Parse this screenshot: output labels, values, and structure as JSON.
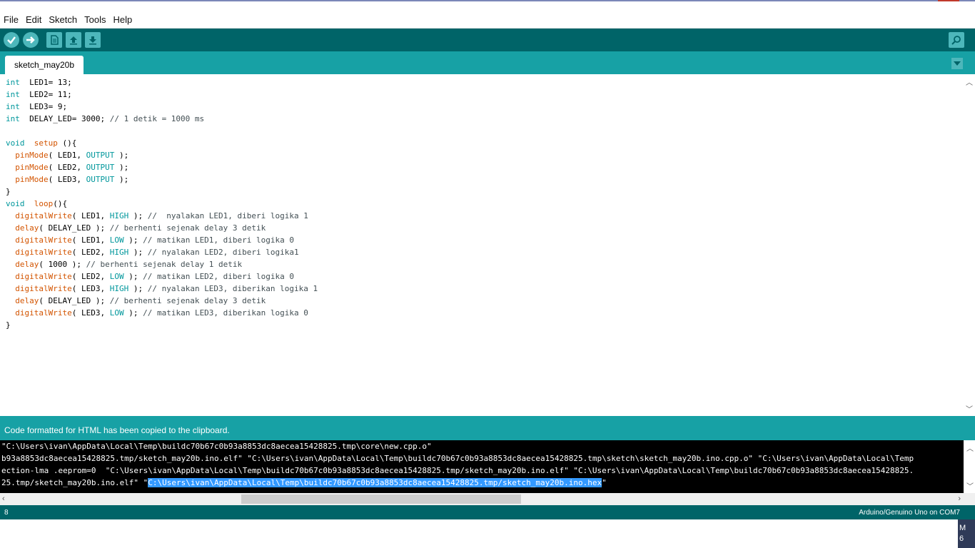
{
  "menu": [
    "File",
    "Edit",
    "Sketch",
    "Tools",
    "Help"
  ],
  "toolbar": {
    "verify": "verify-icon",
    "upload": "upload-icon",
    "new": "new-icon",
    "open": "open-icon",
    "save": "save-icon",
    "serial_monitor": "serial-monitor-icon"
  },
  "tab": {
    "label": "sketch_may20b"
  },
  "code_lines": [
    [
      [
        "kw",
        "int"
      ],
      [
        "",
        "  LED1= 13;"
      ]
    ],
    [
      [
        "kw",
        "int"
      ],
      [
        "",
        "  LED2= 11;"
      ]
    ],
    [
      [
        "kw",
        "int"
      ],
      [
        "",
        "  LED3= 9;"
      ]
    ],
    [
      [
        "kw",
        "int"
      ],
      [
        "",
        "  DELAY_LED= 3000; "
      ],
      [
        "cmt",
        "// 1 detik = 1000 ms"
      ]
    ],
    [],
    [
      [
        "kw",
        "void"
      ],
      [
        "",
        "  "
      ],
      [
        "fn",
        "setup"
      ],
      [
        "",
        " (){"
      ]
    ],
    [
      [
        "",
        "  "
      ],
      [
        "fn",
        "pinMode"
      ],
      [
        "",
        "( LED1, "
      ],
      [
        "kw",
        "OUTPUT"
      ],
      [
        "",
        " );"
      ]
    ],
    [
      [
        "",
        "  "
      ],
      [
        "fn",
        "pinMode"
      ],
      [
        "",
        "( LED2, "
      ],
      [
        "kw",
        "OUTPUT"
      ],
      [
        "",
        " );"
      ]
    ],
    [
      [
        "",
        "  "
      ],
      [
        "fn",
        "pinMode"
      ],
      [
        "",
        "( LED3, "
      ],
      [
        "kw",
        "OUTPUT"
      ],
      [
        "",
        " );"
      ]
    ],
    [
      [
        "",
        "}"
      ]
    ],
    [
      [
        "kw",
        "void"
      ],
      [
        "",
        "  "
      ],
      [
        "fn",
        "loop"
      ],
      [
        "",
        "(){"
      ]
    ],
    [
      [
        "",
        "  "
      ],
      [
        "fn",
        "digitalWrite"
      ],
      [
        "",
        "( LED1, "
      ],
      [
        "kw",
        "HIGH"
      ],
      [
        "",
        " ); "
      ],
      [
        "cmt",
        "//  nyalakan LED1, diberi logika 1"
      ]
    ],
    [
      [
        "",
        "  "
      ],
      [
        "fn",
        "delay"
      ],
      [
        "",
        "( DELAY_LED ); "
      ],
      [
        "cmt",
        "// berhenti sejenak delay 3 detik"
      ]
    ],
    [
      [
        "",
        "  "
      ],
      [
        "fn",
        "digitalWrite"
      ],
      [
        "",
        "( LED1, "
      ],
      [
        "kw",
        "LOW"
      ],
      [
        "",
        " ); "
      ],
      [
        "cmt",
        "// matikan LED1, diberi logika 0"
      ]
    ],
    [
      [
        "",
        "  "
      ],
      [
        "fn",
        "digitalWrite"
      ],
      [
        "",
        "( LED2, "
      ],
      [
        "kw",
        "HIGH"
      ],
      [
        "",
        " ); "
      ],
      [
        "cmt",
        "// nyalakan LED2, diberi logika1"
      ]
    ],
    [
      [
        "",
        "  "
      ],
      [
        "fn",
        "delay"
      ],
      [
        "",
        "( 1000 ); "
      ],
      [
        "cmt",
        "// berhenti sejenak delay 1 detik"
      ]
    ],
    [
      [
        "",
        "  "
      ],
      [
        "fn",
        "digitalWrite"
      ],
      [
        "",
        "( LED2, "
      ],
      [
        "kw",
        "LOW"
      ],
      [
        "",
        " ); "
      ],
      [
        "cmt",
        "// matikan LED2, diberi logika 0"
      ]
    ],
    [
      [
        "",
        "  "
      ],
      [
        "fn",
        "digitalWrite"
      ],
      [
        "",
        "( LED3, "
      ],
      [
        "kw",
        "HIGH"
      ],
      [
        "",
        " ); "
      ],
      [
        "cmt",
        "// nyalakan LED3, diberikan logika 1"
      ]
    ],
    [
      [
        "",
        "  "
      ],
      [
        "fn",
        "delay"
      ],
      [
        "",
        "( DELAY_LED ); "
      ],
      [
        "cmt",
        "// berhenti sejenak delay 3 detik"
      ]
    ],
    [
      [
        "",
        "  "
      ],
      [
        "fn",
        "digitalWrite"
      ],
      [
        "",
        "( LED3, "
      ],
      [
        "kw",
        "LOW"
      ],
      [
        "",
        " ); "
      ],
      [
        "cmt",
        "// matikan LED3, diberikan logika 0"
      ]
    ],
    [
      [
        "",
        "}"
      ]
    ]
  ],
  "status_message": "Code formatted for HTML has been copied to the clipboard.",
  "console_lines": [
    "\"C:\\Users\\ivan\\AppData\\Local\\Temp\\buildc70b67c0b93a8853dc8aecea15428825.tmp\\core\\new.cpp.o\"",
    "b93a8853dc8aecea15428825.tmp/sketch_may20b.ino.elf\" \"C:\\Users\\ivan\\AppData\\Local\\Temp\\buildc70b67c0b93a8853dc8aecea15428825.tmp\\sketch\\sketch_may20b.ino.cpp.o\" \"C:\\Users\\ivan\\AppData\\Local\\Temp",
    "ection-lma .eeprom=0  \"C:\\Users\\ivan\\AppData\\Local\\Temp\\buildc70b67c0b93a8853dc8aecea15428825.tmp/sketch_may20b.ino.elf\" \"C:\\Users\\ivan\\AppData\\Local\\Temp\\buildc70b67c0b93a8853dc8aecea15428825.",
    "25.tmp/sketch_may20b.ino.elf\" \""
  ],
  "console_selected": "C:\\Users\\ivan\\AppData\\Local\\Temp\\buildc70b67c0b93a8853dc8aecea15428825.tmp/sketch_may20b.ino.hex",
  "console_after": "\"",
  "bottom": {
    "line": "8",
    "board": "Arduino/Genuino Uno on COM7"
  },
  "taskbar_text": [
    "M",
    "6"
  ],
  "colors": {
    "toolbar": "#006468",
    "tabbar": "#17a1a5",
    "button": "#4db7bb",
    "selection": "#3399ff"
  }
}
